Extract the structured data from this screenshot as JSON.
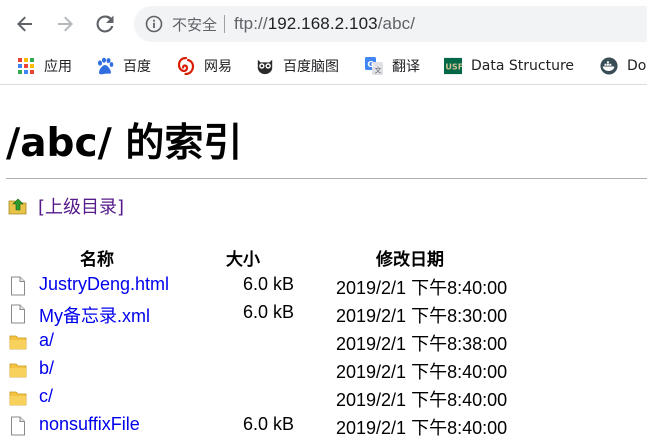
{
  "toolbar": {
    "security_label": "不安全",
    "separator": "|",
    "url_scheme": "ftp://",
    "url_host": "192.168.2.103",
    "url_path": "/abc/"
  },
  "bookmarks": [
    {
      "label": "应用",
      "icon": "apps-grid-icon"
    },
    {
      "label": "百度",
      "icon": "baidu-paw-icon"
    },
    {
      "label": "网易",
      "icon": "netease-icon"
    },
    {
      "label": "百度脑图",
      "icon": "owl-icon"
    },
    {
      "label": "翻译",
      "icon": "google-translate-icon"
    },
    {
      "label": "Data Structure",
      "icon": "usf-icon"
    },
    {
      "label": "Do",
      "icon": "docker-icon"
    }
  ],
  "page": {
    "title": "/abc/ 的索引",
    "parent_link": "[上级目录]",
    "columns": {
      "name": "名称",
      "size": "大小",
      "modified": "修改日期"
    },
    "files": [
      {
        "name": "JustryDeng.html",
        "size": "6.0 kB",
        "modified": "2019/2/1 下午8:40:00",
        "type": "file"
      },
      {
        "name": "My备忘录.xml",
        "size": "6.0 kB",
        "modified": "2019/2/1 下午8:30:00",
        "type": "file"
      },
      {
        "name": "a/",
        "size": "",
        "modified": "2019/2/1 下午8:38:00",
        "type": "folder"
      },
      {
        "name": "b/",
        "size": "",
        "modified": "2019/2/1 下午8:40:00",
        "type": "folder"
      },
      {
        "name": "c/",
        "size": "",
        "modified": "2019/2/1 下午8:40:00",
        "type": "folder"
      },
      {
        "name": "nonsuffixFile",
        "size": "6.0 kB",
        "modified": "2019/2/1 下午8:40:00",
        "type": "file"
      }
    ]
  },
  "colors": {
    "link": "#0000ee",
    "visited_link": "#551a8b",
    "folder": "#f5c242",
    "omnibox_bg": "#f1f3f4"
  }
}
